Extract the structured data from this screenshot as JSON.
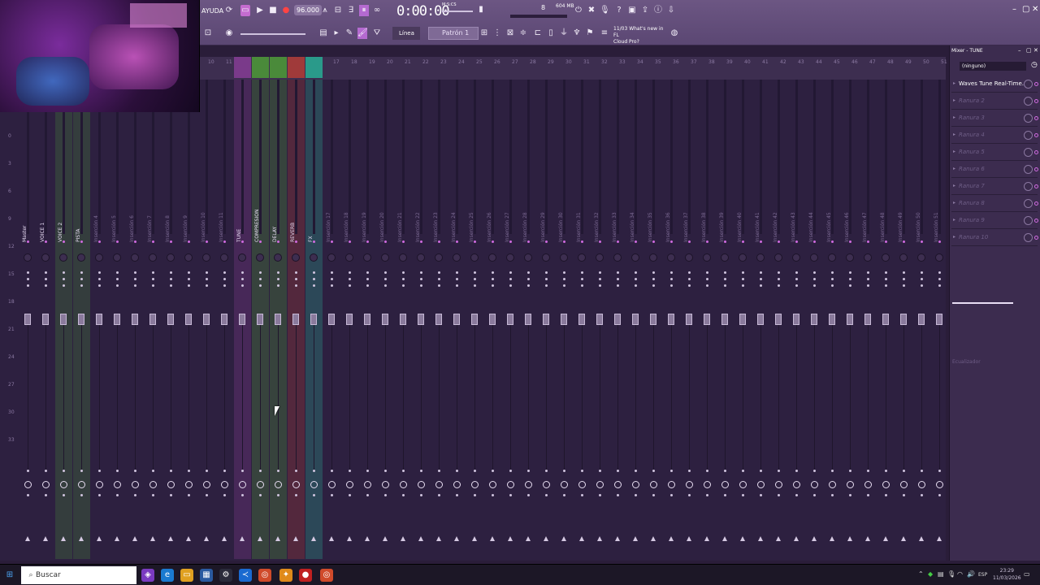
{
  "toolbar": {
    "app_label": "AYUDA",
    "tempo": "96.000",
    "time": "0:00:00",
    "cpu_label": "604 MB",
    "cpu_value": "8",
    "line_label": "Línea",
    "pattern_label": "Patrón 1",
    "news_line1": "11/03  What's new in FL",
    "news_line2": "Cloud Pro?"
  },
  "ruler": [
    "10",
    "11",
    "12",
    "13",
    "14",
    "15",
    "16",
    "17",
    "18",
    "19",
    "20",
    "21",
    "22",
    "23",
    "24",
    "25",
    "26",
    "27",
    "28",
    "29",
    "30",
    "31",
    "32",
    "33",
    "34",
    "35",
    "36",
    "37",
    "38",
    "39",
    "40",
    "41",
    "42",
    "43",
    "44",
    "45",
    "46",
    "47",
    "48",
    "49",
    "50",
    "51"
  ],
  "channels": [
    {
      "label": "Master"
    },
    {
      "label": "VOICE 1"
    },
    {
      "label": "VOICE 2"
    },
    {
      "label": "PISTA"
    },
    {
      "label": "Inserción 4"
    },
    {
      "label": "Inserción 5"
    },
    {
      "label": "Inserción 6"
    },
    {
      "label": "Inserción 7"
    },
    {
      "label": "Inserción 8"
    },
    {
      "label": "Inserción 9"
    },
    {
      "label": "Inserción 10"
    },
    {
      "label": "Inserción 11"
    },
    {
      "label": "TUNE"
    },
    {
      "label": "COMPRESION"
    },
    {
      "label": "DELAY"
    },
    {
      "label": "REVERB"
    },
    {
      "label": "FX"
    },
    {
      "label": "Inserción 17"
    },
    {
      "label": "Inserción 18"
    },
    {
      "label": "Inserción 19"
    },
    {
      "label": "Inserción 20"
    },
    {
      "label": "Inserción 21"
    },
    {
      "label": "Inserción 22"
    },
    {
      "label": "Inserción 23"
    },
    {
      "label": "Inserción 24"
    },
    {
      "label": "Inserción 25"
    },
    {
      "label": "Inserción 26"
    },
    {
      "label": "Inserción 27"
    },
    {
      "label": "Inserción 28"
    },
    {
      "label": "Inserción 29"
    },
    {
      "label": "Inserción 30"
    },
    {
      "label": "Inserción 31"
    },
    {
      "label": "Inserción 32"
    },
    {
      "label": "Inserción 33"
    },
    {
      "label": "Inserción 34"
    },
    {
      "label": "Inserción 35"
    },
    {
      "label": "Inserción 36"
    },
    {
      "label": "Inserción 37"
    },
    {
      "label": "Inserción 38"
    },
    {
      "label": "Inserción 39"
    },
    {
      "label": "Inserción 40"
    },
    {
      "label": "Inserción 41"
    },
    {
      "label": "Inserción 42"
    },
    {
      "label": "Inserción 43"
    },
    {
      "label": "Inserción 44"
    },
    {
      "label": "Inserción 45"
    },
    {
      "label": "Inserción 46"
    },
    {
      "label": "Inserción 47"
    },
    {
      "label": "Inserción 48"
    },
    {
      "label": "Inserción 49"
    },
    {
      "label": "Inserción 50"
    },
    {
      "label": "Inserción 51"
    }
  ],
  "db_scale": [
    "0",
    "3",
    "6",
    "9",
    "12",
    "15",
    "18",
    "21",
    "24",
    "27",
    "30",
    "33"
  ],
  "right_panel": {
    "title": "Mixer - TUNE",
    "preset": "(ninguno)",
    "slots": [
      {
        "name": "Waves Tune Real-Time...",
        "active": true
      },
      {
        "name": "Ranura 2",
        "active": false
      },
      {
        "name": "Ranura 3",
        "active": false
      },
      {
        "name": "Ranura 4",
        "active": false
      },
      {
        "name": "Ranura 5",
        "active": false
      },
      {
        "name": "Ranura 6",
        "active": false
      },
      {
        "name": "Ranura 7",
        "active": false
      },
      {
        "name": "Ranura 8",
        "active": false
      },
      {
        "name": "Ranura 9",
        "active": false
      },
      {
        "name": "Ranura 10",
        "active": false
      }
    ],
    "eq_label": "Ecualizador"
  },
  "taskbar": {
    "search_placeholder": "Buscar",
    "time": "23:29",
    "date": "11/03/2026",
    "lang": "ESP"
  },
  "colors": {
    "accent": "#d06be0",
    "tune": "#7a3a8a",
    "compresion": "#4a8a3a",
    "delay": "#4a8a3a",
    "reverb": "#a03a3a",
    "fx": "#2a9a8a"
  }
}
